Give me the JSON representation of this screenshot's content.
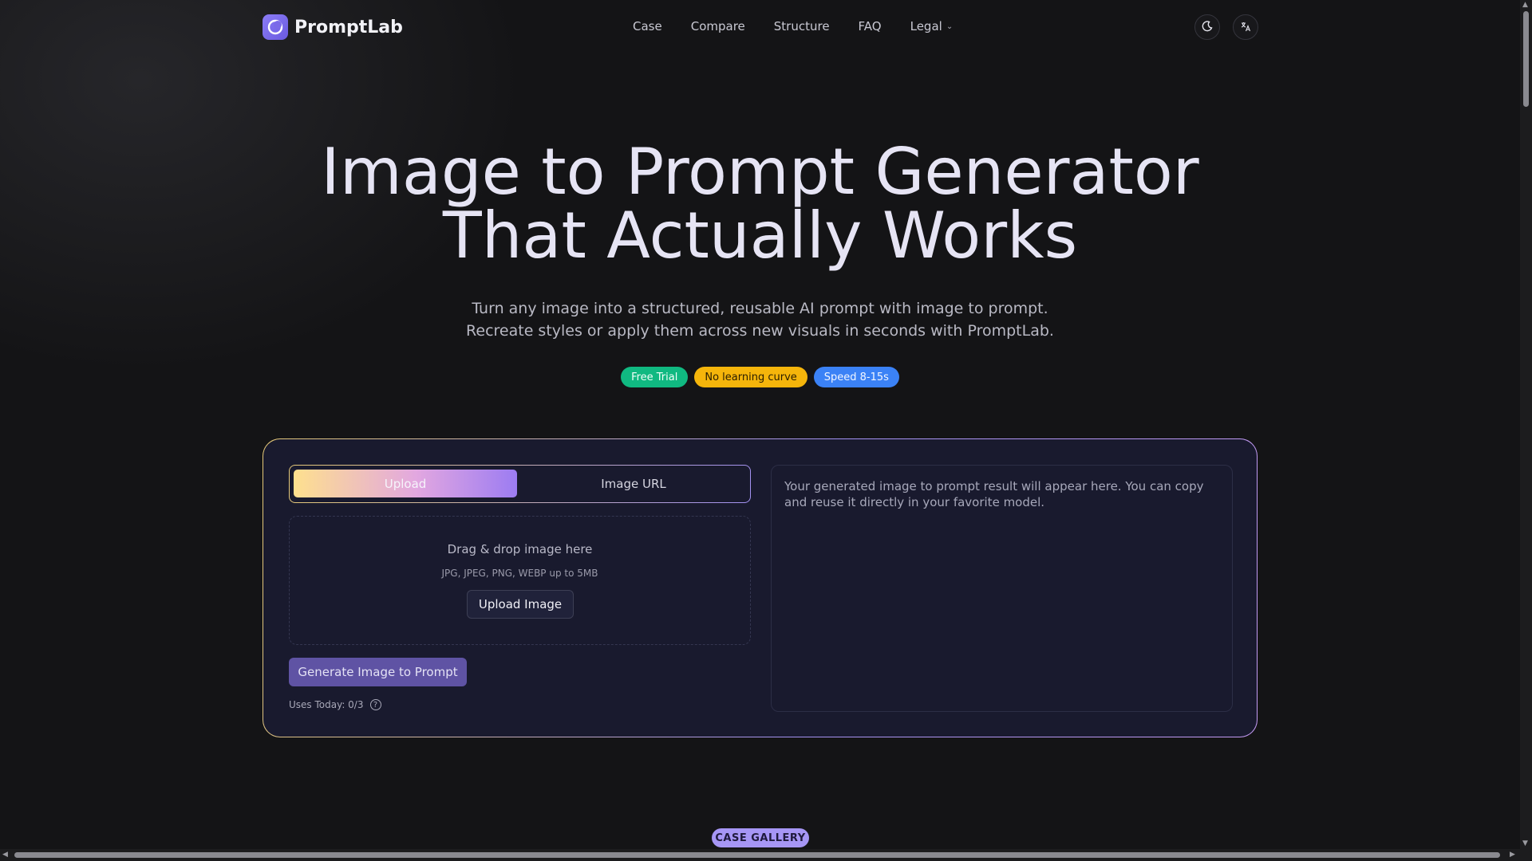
{
  "brand": {
    "name": "PromptLab"
  },
  "nav": {
    "items": [
      "Case",
      "Compare",
      "Structure",
      "FAQ"
    ],
    "legal": "Legal"
  },
  "hero": {
    "title_line1": "Image to Prompt Generator",
    "title_line2": "That Actually Works",
    "sub_line1": "Turn any image into a structured, reusable AI prompt with image to prompt.",
    "sub_line2": "Recreate styles or apply them across new visuals in seconds with PromptLab."
  },
  "badges": [
    {
      "label": "Free Trial",
      "color": "#10b981"
    },
    {
      "label": "No learning curve",
      "color": "#f5b50b"
    },
    {
      "label": "Speed 8-15s",
      "color": "#3b82f6"
    }
  ],
  "tool": {
    "tab_upload": "Upload",
    "tab_url": "Image URL",
    "dropzone_title": "Drag & drop image here",
    "dropzone_hint": "JPG, JPEG, PNG, WEBP up to 5MB",
    "upload_button": "Upload Image",
    "generate_button": "Generate Image to Prompt",
    "uses_today": "Uses Today: 0/3",
    "result_placeholder": "Your generated image to prompt result will appear here. You can copy and reuse it directly in your favorite model."
  },
  "gallery_label": "CASE GALLERY",
  "icons": {
    "logo": "logo-icon",
    "theme": "moon-icon",
    "language": "translate-icon",
    "help": "help-circle-icon"
  }
}
